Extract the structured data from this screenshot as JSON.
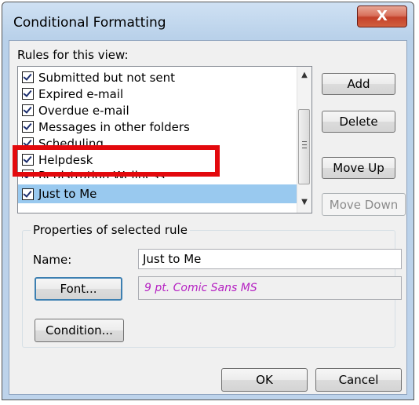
{
  "window": {
    "title": "Conditional Formatting",
    "close_glyph": "X"
  },
  "rules": {
    "label": "Rules for this view:",
    "items": [
      {
        "label": "Submitted but not sent",
        "checked": true
      },
      {
        "label": "Expired e-mail",
        "checked": true
      },
      {
        "label": "Overdue e-mail",
        "checked": true
      },
      {
        "label": "Messages in other folders",
        "checked": true
      },
      {
        "label": "Scheduling",
        "checked": true
      },
      {
        "label": "Helpdesk",
        "checked": true
      },
      {
        "label": "Registration Wellness",
        "checked": true
      },
      {
        "label": "Just to Me",
        "checked": true,
        "selected": true
      }
    ],
    "scroll_up_glyph": "▲",
    "scroll_down_glyph": "▼"
  },
  "buttons": {
    "add": "Add",
    "delete": "Delete",
    "move_up": "Move Up",
    "move_down": "Move Down",
    "ok": "OK",
    "cancel": "Cancel"
  },
  "properties": {
    "group_title": "Properties of selected rule",
    "name_label": "Name:",
    "name_value": "Just to Me",
    "font_button": "Font...",
    "font_sample": "9 pt. Comic Sans MS",
    "condition_button": "Condition..."
  },
  "colors": {
    "selection": "#99c9ef",
    "highlight_box": "#e3090d",
    "font_sample": "#b521c2"
  },
  "icons": {
    "close": "close-icon",
    "checkbox": "checkbox-checked-icon",
    "scroll_up": "scroll-up-arrow-icon",
    "scroll_down": "scroll-down-arrow-icon"
  }
}
